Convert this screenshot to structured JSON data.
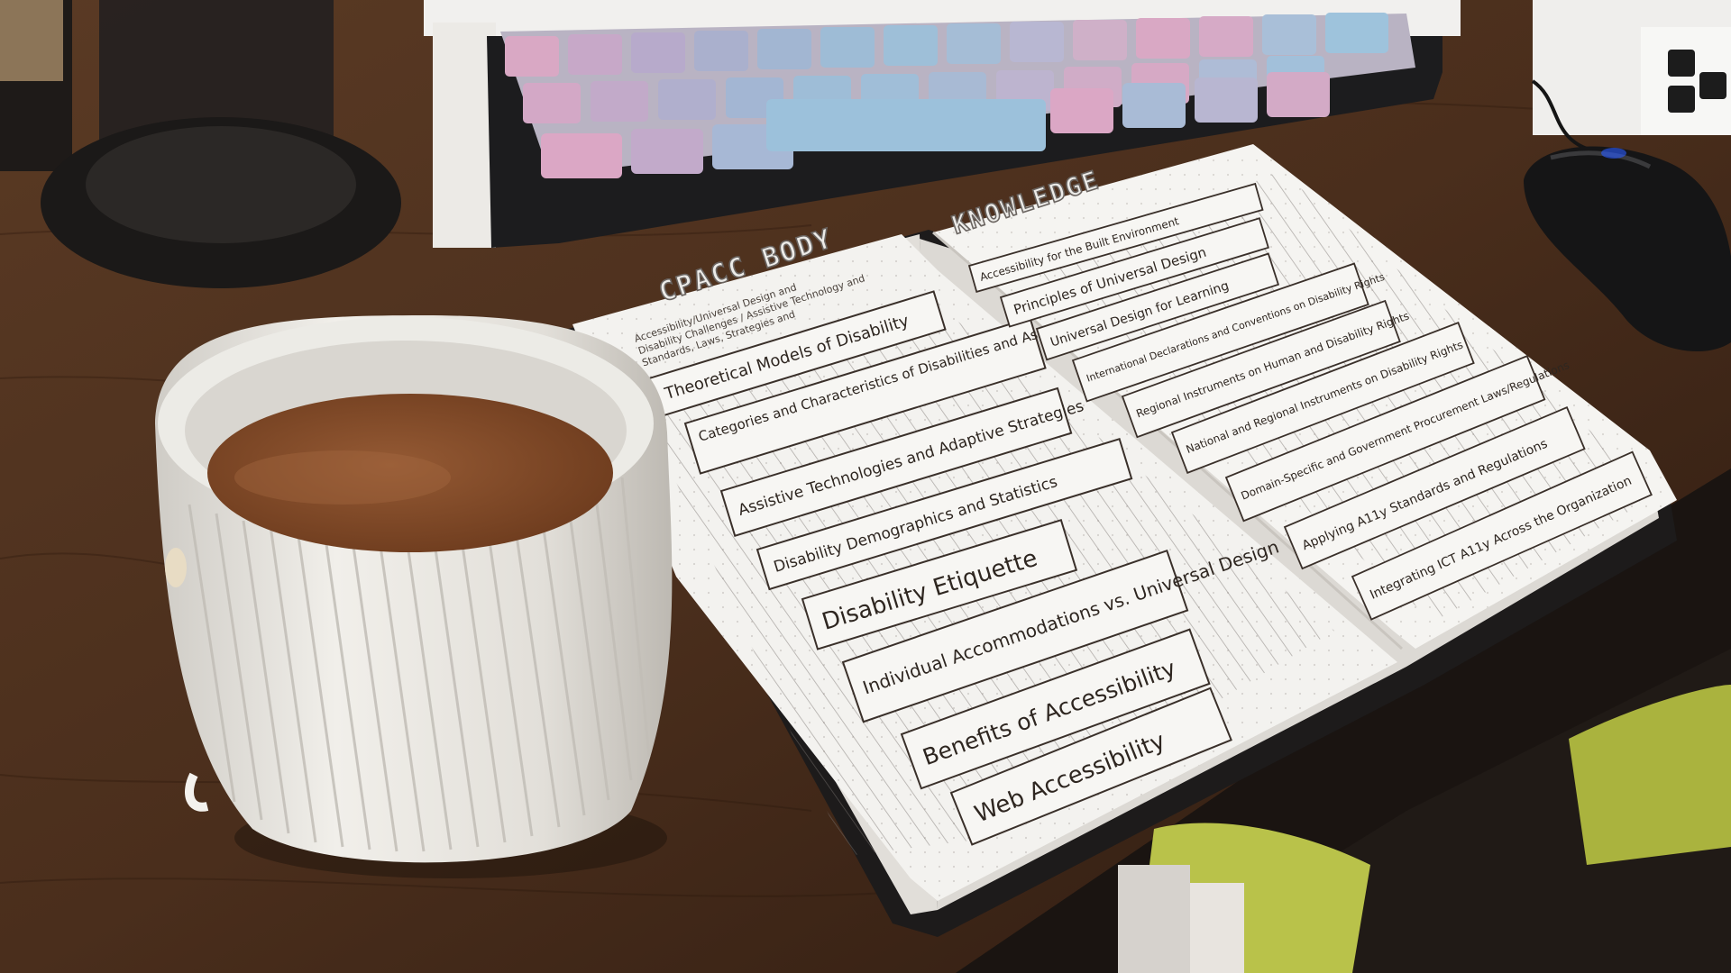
{
  "left_page": {
    "heading": "CPACC BODY",
    "notes": [
      "Accessibility/Universal Design and",
      "Disability Challenges / Assistive Technology and",
      "Standards, Laws, Strategies and"
    ],
    "banners": [
      {
        "label": "Theoretical Models of Disability"
      },
      {
        "label": "Categories and Characteristics of Disabilities and Associated Barriers"
      },
      {
        "label": "Assistive Technologies and Adaptive Strategies"
      },
      {
        "label": "Disability Demographics and Statistics"
      },
      {
        "label": "Disability Etiquette"
      },
      {
        "label": "Individual Accommodations vs. Universal Design"
      },
      {
        "label": "Benefits of Accessibility"
      },
      {
        "label": "Web Accessibility"
      }
    ]
  },
  "right_page": {
    "heading": "KNOWLEDGE",
    "banners": [
      {
        "label": "Accessibility for the Built Environment"
      },
      {
        "label": "Principles of Universal Design"
      },
      {
        "label": "Universal Design for Learning"
      },
      {
        "label": "International Declarations and Conventions on Disability Rights"
      },
      {
        "label": "Regional Instruments on Human and Disability Rights"
      },
      {
        "label": "National and Regional Instruments on Disability Rights"
      },
      {
        "label": "Domain-Specific and Government Procurement Laws/Regulations"
      },
      {
        "label": "Applying A11y Standards and Regulations"
      },
      {
        "label": "Integrating ICT A11y Across the Organization"
      }
    ]
  },
  "colors": {
    "desk": "#4a2e1c",
    "coffee": "#8a4f2c",
    "mug": "#e9e7e2",
    "page": "#f3f2ef",
    "ink": "#2e2620"
  }
}
